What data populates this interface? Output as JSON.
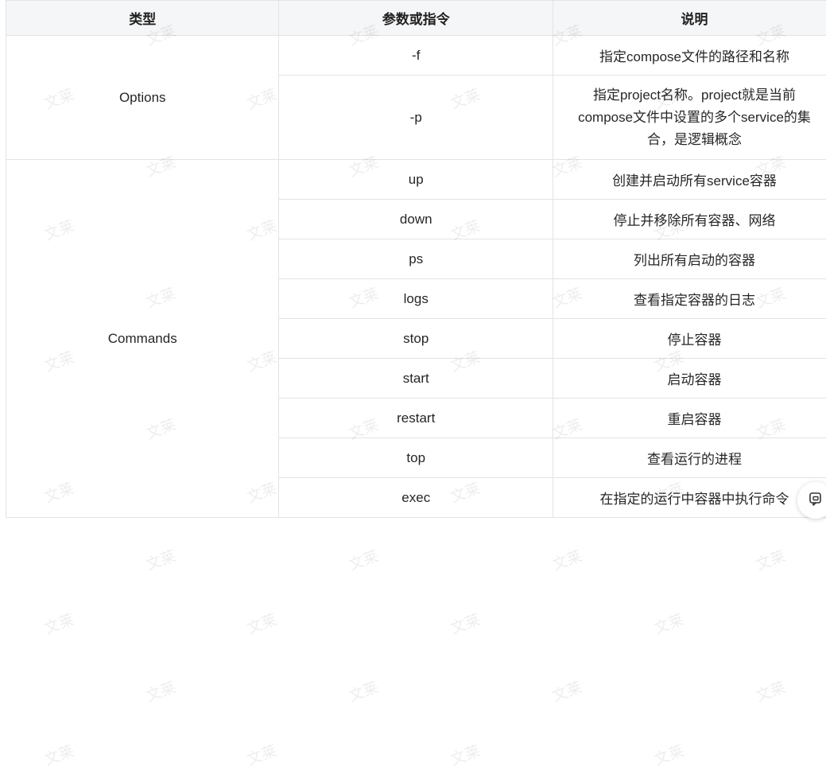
{
  "table": {
    "headers": [
      "类型",
      "参数或指令",
      "说明"
    ],
    "groups": [
      {
        "type": "Options",
        "rows": [
          {
            "arg": "-f",
            "desc": "指定compose文件的路径和名称"
          },
          {
            "arg": "-p",
            "desc_lines": [
              "指定project名称。project就是当前",
              "compose文件中设置的多个service的集",
              "合，是逻辑概念"
            ]
          }
        ]
      },
      {
        "type": "Commands",
        "rows": [
          {
            "arg": "up",
            "desc": "创建并启动所有service容器"
          },
          {
            "arg": "down",
            "desc": "停止并移除所有容器、网络"
          },
          {
            "arg": "ps",
            "desc": "列出所有启动的容器"
          },
          {
            "arg": "logs",
            "desc": "查看指定容器的日志"
          },
          {
            "arg": "stop",
            "desc": "停止容器"
          },
          {
            "arg": "start",
            "desc": "启动容器"
          },
          {
            "arg": "restart",
            "desc": "重启容器"
          },
          {
            "arg": "top",
            "desc": "查看运行的进程"
          },
          {
            "arg": "exec",
            "desc": "在指定的运行中容器中执行命令"
          }
        ]
      }
    ]
  },
  "watermark_text": "文莱",
  "floating_button": {
    "icon": "comment-icon"
  }
}
